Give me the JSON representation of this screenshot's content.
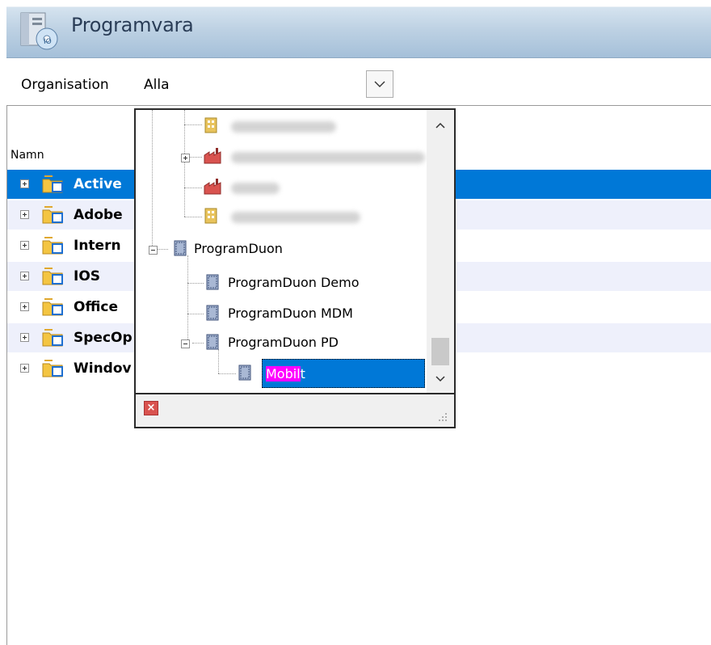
{
  "header": {
    "title": "Programvara"
  },
  "org": {
    "label": "Organisation",
    "value": "Alla"
  },
  "list": {
    "column_header": "Namn",
    "rows": [
      {
        "label": "Active",
        "state": "selected"
      },
      {
        "label": "Adobe",
        "state": "alt"
      },
      {
        "label": "Intern",
        "state": "normal"
      },
      {
        "label": "IOS",
        "state": "alt"
      },
      {
        "label": "Office",
        "state": "normal"
      },
      {
        "label": "SpecOp",
        "state": "alt"
      },
      {
        "label": "Windov",
        "state": "normal"
      }
    ]
  },
  "popup": {
    "tree": [
      {
        "label": "ProgramDuon"
      },
      {
        "label": "ProgramDuon Demo"
      },
      {
        "label": "ProgramDuon MDM"
      },
      {
        "label": "ProgramDuon PD"
      }
    ],
    "selected": {
      "highlight": "Mobil",
      "rest": "t"
    },
    "close_icon": "close-icon",
    "colors": {
      "selection": "#0078d7",
      "search_highlight": "#ff00ff"
    }
  }
}
